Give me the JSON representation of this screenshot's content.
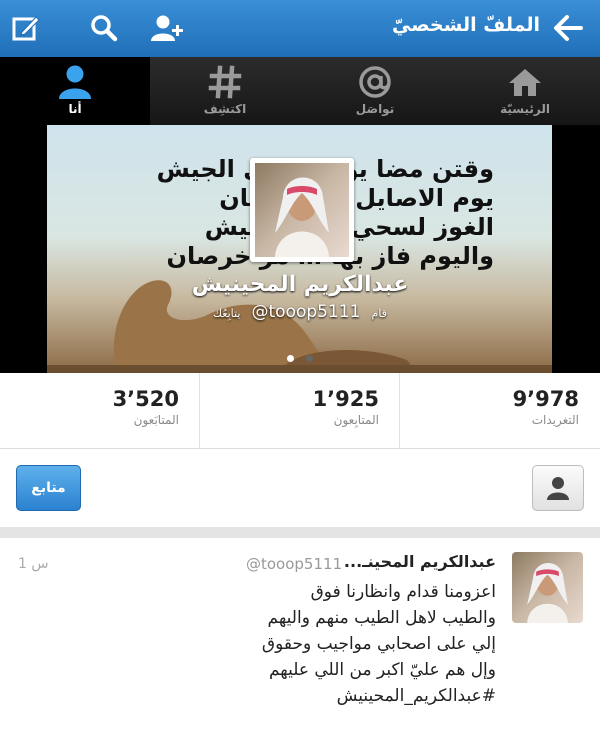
{
  "header": {
    "title": "الملفّ الشخصيّ",
    "back_icon": "arrow-left-icon",
    "add_user_icon": "add-user-icon",
    "search_icon": "search-icon",
    "compose_icon": "compose-icon"
  },
  "tabs": [
    {
      "label": "الرئيسيّة",
      "icon": "home-icon"
    },
    {
      "label": "تواصَل",
      "icon": "at-icon"
    },
    {
      "label": "اكتشِف",
      "icon": "hash-icon"
    },
    {
      "label": "أنا",
      "icon": "person-icon"
    }
  ],
  "profile": {
    "poem_lines": [
      "وقتن مضا يوم… على الجيش",
      "يوم الاصايل … لها شان",
      "الغوز لسحي… المحينيش",
      "واليوم فاز بها … مر خرصان"
    ],
    "name": "عبدالكريم المحينيش",
    "handle": "@tooop5111",
    "follows_you": "يتابِعُك",
    "action_hint": "قام"
  },
  "stats": [
    {
      "value": "9٬978",
      "label": "التغريدات"
    },
    {
      "value": "1٬925",
      "label": "المتابِعون"
    },
    {
      "value": "3٬520",
      "label": "المتابَعون"
    }
  ],
  "actions": {
    "follow_label": "متابع"
  },
  "tweet": {
    "name": "عبدالكريم المحينـ...",
    "handle": "@tooop5111",
    "time": "1 س",
    "lines": [
      "اعزومنا قدام وانظارنا فوق",
      "والطيب لاهل الطيب منهم واليهم",
      "إلي على اصحابي مواجيب وحقوق",
      "وإل هم عليّ اكبر من اللي عليهم",
      "#عبدالكريم_المحينيش"
    ]
  },
  "colors": {
    "header_blue": "#2a80c9",
    "tab_dark": "#1c1c1c",
    "follow_blue": "#3a94dd"
  }
}
